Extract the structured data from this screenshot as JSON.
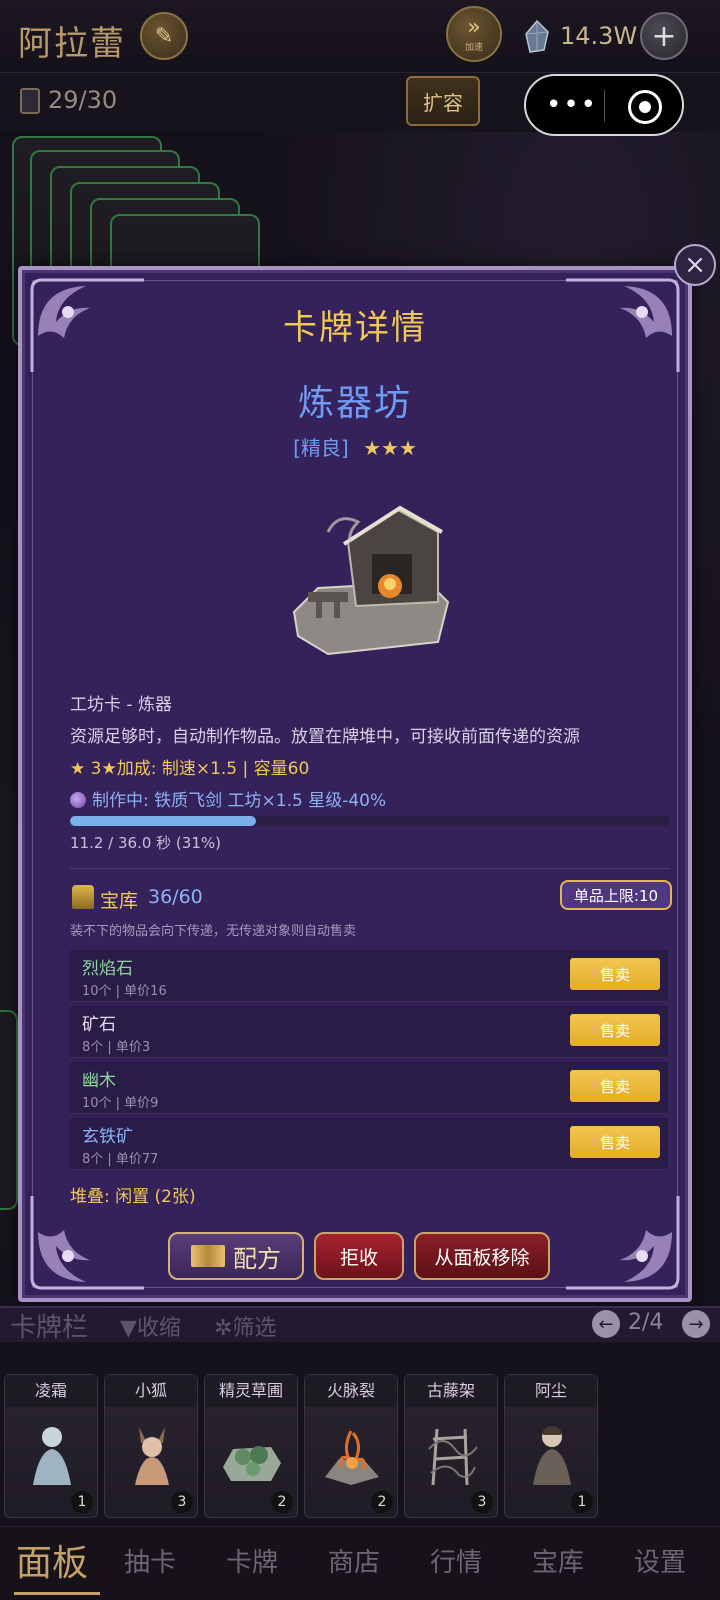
{
  "topbar": {
    "city_name": "阿拉蕾",
    "speed_label": "加速",
    "gem_count": "14.3W",
    "deck_count": "29/30",
    "expand_label": "扩容",
    "capsule_dots": "•••"
  },
  "modal": {
    "title": "卡牌详情",
    "card_name": "炼器坊",
    "quality": "[精良]",
    "stars": "★★★",
    "card_type": "工坊卡 - 炼器",
    "description": "资源足够时，自动制作物品。放置在牌堆中，可接收前面传递的资源",
    "bonus": "★ 3★加成: 制速×1.5 | 容量60",
    "crafting": "制作中: 铁质飞剑  工坊×1.5 星级-40%",
    "progress_fraction": 0.31,
    "progress_text": "11.2 / 36.0 秒 (31%)",
    "vault": {
      "title": "宝库",
      "count": "36/60",
      "limit_badge": "单品上限:10",
      "note": "装不下的物品会向下传递，无传递对象则自动售卖",
      "sell_label": "售卖",
      "items": [
        {
          "name": "烈焰石",
          "meta": "10个 | 单价16",
          "color": "#8fd4a0"
        },
        {
          "name": "矿石",
          "meta": "8个 | 单价3",
          "color": "#e4dcee"
        },
        {
          "name": "幽木",
          "meta": "10个 | 单价9",
          "color": "#8fd4a0"
        },
        {
          "name": "玄铁矿",
          "meta": "8个 | 单价77",
          "color": "#8db2f5"
        }
      ]
    },
    "stack_info": "堆叠: 闲置 (2张)",
    "buttons": {
      "recipe": "配方",
      "reject": "拒收",
      "remove": "从面板移除"
    },
    "close_icon": "×"
  },
  "card_bar": {
    "title": "卡牌栏",
    "collapse": "▼收缩",
    "filter": "✲筛选",
    "page": "2/4",
    "prev_icon": "←",
    "next_icon": "→",
    "cards": [
      {
        "name": "凌霜",
        "count": "1"
      },
      {
        "name": "小狐",
        "count": "3"
      },
      {
        "name": "精灵草圃",
        "count": "2"
      },
      {
        "name": "火脉裂",
        "count": "2"
      },
      {
        "name": "古藤架",
        "count": "3"
      },
      {
        "name": "阿尘",
        "count": "1"
      }
    ]
  },
  "nav": {
    "items": [
      "面板",
      "抽卡",
      "卡牌",
      "商店",
      "行情",
      "宝库",
      "设置"
    ],
    "active_index": 0
  },
  "colors": {
    "gold": "#f0c857",
    "blue": "#6f9cf2",
    "modal_bg": "#35225a",
    "sell_button": "#f2c64e",
    "progress": "#7bb1ea"
  }
}
